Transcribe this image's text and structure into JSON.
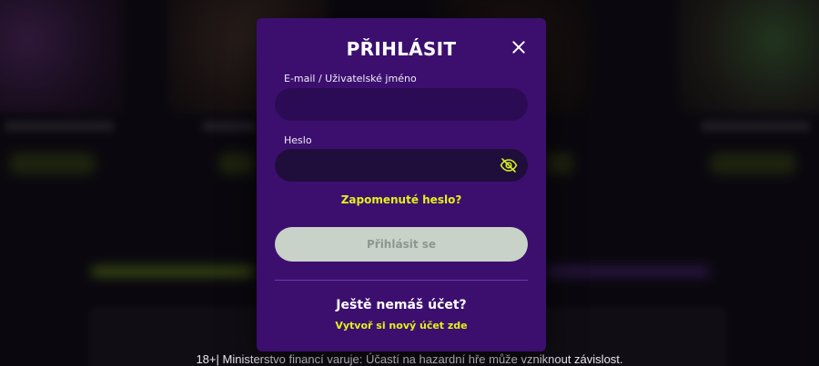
{
  "modal": {
    "title": "PŘIHLÁSIT",
    "email_label": "E-mail / Uživatelské jméno",
    "email_value": "",
    "password_label": "Heslo",
    "password_value": "",
    "forgot_password": "Zapomenuté heslo?",
    "submit_label": "Přihlásit se",
    "no_account_text": "Ještě nemáš účet?",
    "register_link": "Vytvoř si nový účet zde"
  },
  "footer": {
    "warning": "18+| Ministerstvo financí varuje: Účastí na hazardní hře může vzniknout závislost."
  },
  "colors": {
    "modal_bg": "#3c0f6f",
    "accent": "#e3f21a",
    "button_disabled": "#c8d2c8"
  },
  "icons": {
    "close": "close-icon",
    "password_visibility": "eye-slash-icon"
  }
}
